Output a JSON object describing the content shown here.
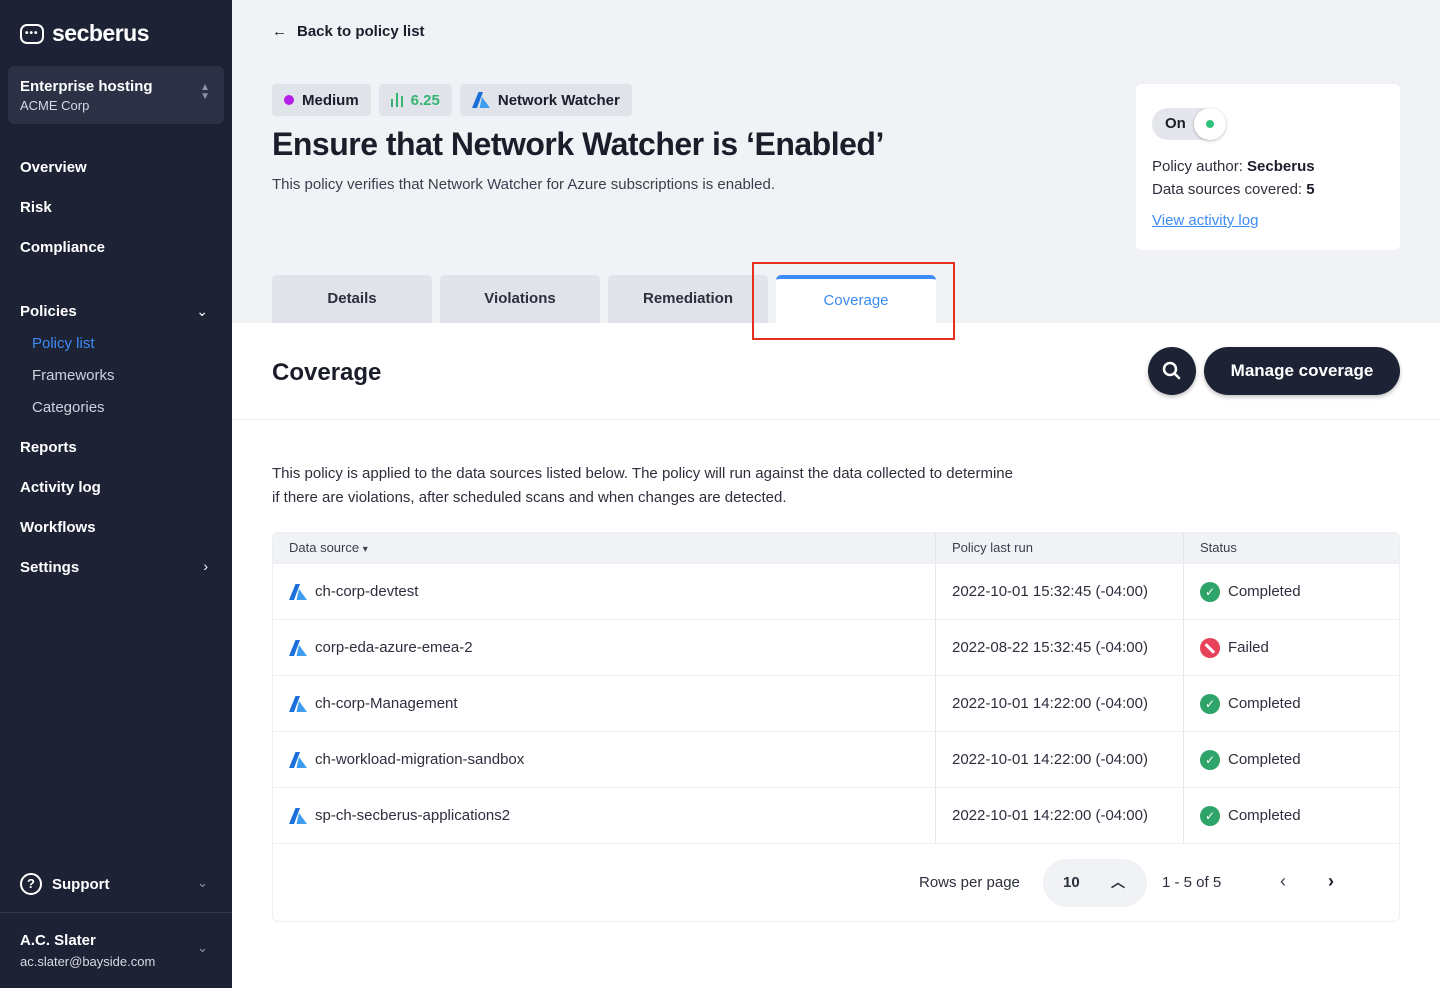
{
  "app": {
    "logo_text": "secberus"
  },
  "org": {
    "name": "Enterprise hosting",
    "sub": "ACME Corp"
  },
  "nav": {
    "overview": "Overview",
    "risk": "Risk",
    "compliance": "Compliance",
    "policies": "Policies",
    "policy_list": "Policy list",
    "frameworks": "Frameworks",
    "categories": "Categories",
    "reports": "Reports",
    "activity_log": "Activity log",
    "workflows": "Workflows",
    "settings": "Settings",
    "support": "Support"
  },
  "user": {
    "name": "A.C. Slater",
    "email": "ac.slater@bayside.com"
  },
  "header": {
    "back": "Back to policy list",
    "severity": "Medium",
    "score": "6.25",
    "service": "Network Watcher",
    "title": "Ensure that Network Watcher is ‘Enabled’",
    "description": "This policy verifies that Network Watcher for Azure subscriptions is enabled."
  },
  "card": {
    "toggle_label": "On",
    "author_label": "Policy author: ",
    "author": "Secberus",
    "sources_label": "Data sources covered: ",
    "sources": "5",
    "activity_link": "View activity log"
  },
  "tabs": [
    "Details",
    "Violations",
    "Remediation",
    "Coverage"
  ],
  "coverage": {
    "title": "Coverage",
    "manage_button": "Manage coverage",
    "intro_line1": "This policy is applied to the data sources listed below. The policy will run against the data collected to determine",
    "intro_line2": "if there are violations, after scheduled scans and when changes are detected."
  },
  "table": {
    "headers": [
      "Data source",
      "Policy last run",
      "Status"
    ],
    "sort_indicator": "▾",
    "rows": [
      {
        "source": "ch-corp-devtest",
        "last_run": "2022-10-01 15:32:45 (-04:00)",
        "status": "Completed"
      },
      {
        "source": "corp-eda-azure-emea-2",
        "last_run": "2022-08-22 15:32:45 (-04:00)",
        "status": "Failed"
      },
      {
        "source": "ch-corp-Management",
        "last_run": "2022-10-01 14:22:00 (-04:00)",
        "status": "Completed"
      },
      {
        "source": "ch-workload-migration-sandbox",
        "last_run": "2022-10-01 14:22:00 (-04:00)",
        "status": "Completed"
      },
      {
        "source": "sp-ch-secberus-applications2",
        "last_run": "2022-10-01 14:22:00 (-04:00)",
        "status": "Completed"
      }
    ]
  },
  "pagination": {
    "rows_per_page_label": "Rows per page",
    "rows_per_page": "10",
    "range": "1 - 5 of 5"
  },
  "colors": {
    "accent": "#3d8bf5",
    "sidebar": "#1e2235",
    "success": "#2ea36a",
    "danger": "#e8415a",
    "severity_medium": "#b51ee8",
    "highlight": "#e4321f"
  }
}
